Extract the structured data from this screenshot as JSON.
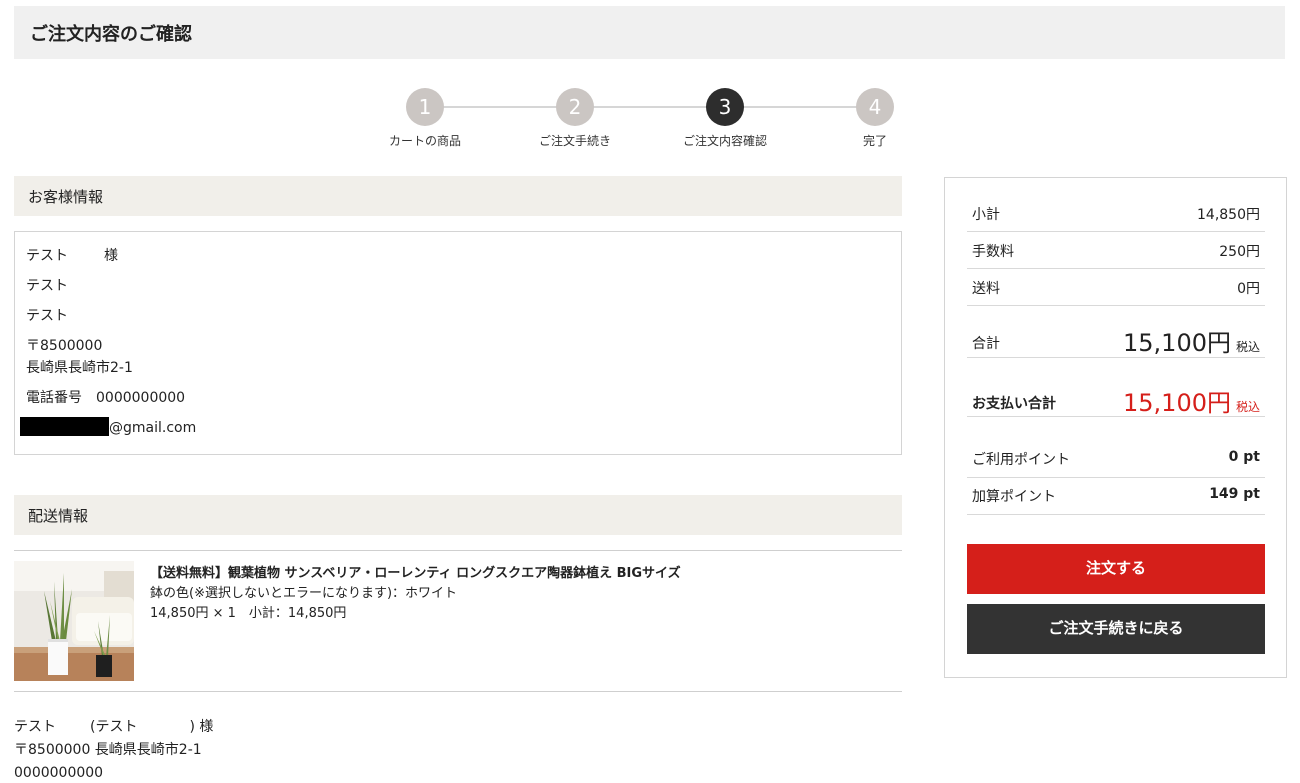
{
  "page": {
    "title": "ご注文内容のご確認"
  },
  "steps": [
    {
      "num": "1",
      "label": "カートの商品"
    },
    {
      "num": "2",
      "label": "ご注文手続き"
    },
    {
      "num": "3",
      "label": "ご注文内容確認"
    },
    {
      "num": "4",
      "label": "完了"
    }
  ],
  "customer": {
    "heading": "お客様情報",
    "name": "テスト",
    "honorific": "様",
    "line2": "テスト",
    "line3": "テスト",
    "zip": "〒8500000",
    "address": "長崎県長崎市2-1",
    "phone_label": "電話番号",
    "phone": "0000000000",
    "email_domain": "@gmail.com"
  },
  "delivery": {
    "heading": "配送情報",
    "product": {
      "name": "【送料無料】観葉植物 サンスベリア・ローレンティ ロングスクエア陶器鉢植え BIGサイズ",
      "option": "鉢の色(※選択しないとエラーになります)：ホワイト",
      "price_line": "14,850円 × 1　小計：14,850円"
    },
    "recipient": {
      "name": "テスト",
      "kana": "(テスト",
      "suffix": ") 様",
      "address_line": "〒8500000 長崎県長崎市2-1",
      "phone": "0000000000"
    }
  },
  "summary": {
    "subtotal_label": "小計",
    "subtotal": "14,850円",
    "fee_label": "手数料",
    "fee": "250円",
    "shipping_label": "送料",
    "shipping": "0円",
    "total_label": "合計",
    "total": "15,100円",
    "tax_note": "税込",
    "pay_label": "お支払い合計",
    "pay_total": "15,100円",
    "pay_tax_note": "税込",
    "used_points_label": "ご利用ポイント",
    "used_points": "0 pt",
    "add_points_label": "加算ポイント",
    "add_points": "149 pt"
  },
  "buttons": {
    "order": "注文する",
    "back": "ご注文手続きに戻る"
  },
  "colors": {
    "accent_red": "#d51f1a",
    "dark": "#333333",
    "section_bg": "#f1efea",
    "step_inactive": "#cbc6c3",
    "step_active": "#2d2d2d"
  }
}
